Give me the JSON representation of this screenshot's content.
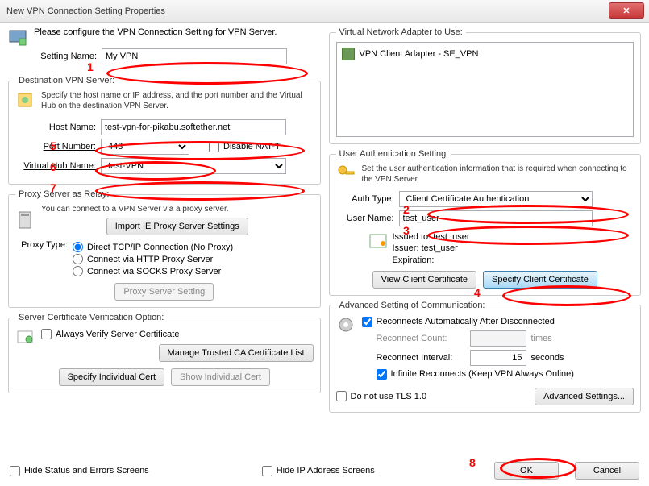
{
  "window": {
    "title": "New VPN Connection Setting Properties"
  },
  "intro": "Please configure the VPN Connection Setting for VPN Server.",
  "setting_name": {
    "label": "Setting Name:",
    "value": "My VPN"
  },
  "dest": {
    "legend": "Destination VPN Server:",
    "note": "Specify the host name or IP address, and the port number and the Virtual Hub on the destination VPN Server.",
    "host_label": "Host Name:",
    "host_value": "test-vpn-for-pikabu.softether.net",
    "port_label": "Port Number:",
    "port_value": "443",
    "nat_label": "Disable NAT-T",
    "hub_label": "Virtual Hub Name:",
    "hub_value": "test-VPN"
  },
  "proxy": {
    "legend": "Proxy Server as Relay:",
    "note": "You can connect to a VPN Server via a proxy server.",
    "import_btn": "Import IE Proxy Server Settings",
    "type_label": "Proxy Type:",
    "opt_direct": "Direct TCP/IP Connection (No Proxy)",
    "opt_http": "Connect via HTTP Proxy Server",
    "opt_socks": "Connect via SOCKS Proxy Server",
    "setting_btn": "Proxy Server Setting"
  },
  "cert": {
    "legend": "Server Certificate Verification Option:",
    "always": "Always Verify Server Certificate",
    "manage_btn": "Manage Trusted CA Certificate List",
    "specify_btn": "Specify Individual Cert",
    "show_btn": "Show Individual Cert"
  },
  "adapter": {
    "legend": "Virtual Network Adapter to Use:",
    "item": "VPN Client Adapter - SE_VPN"
  },
  "auth": {
    "legend": "User Authentication Setting:",
    "note": "Set the user authentication information that is required when connecting to the VPN Server.",
    "type_label": "Auth Type:",
    "type_value": "Client Certificate Authentication",
    "user_label": "User Name:",
    "user_value": "test_user",
    "issued_to": "Issued to: test_user",
    "issuer": "Issuer: test_user",
    "expiration": "Expiration: ",
    "view_btn": "View Client Certificate",
    "specify_btn": "Specify Client Certificate"
  },
  "adv": {
    "legend": "Advanced Setting of Communication:",
    "reconnect_auto": "Reconnects Automatically After Disconnected",
    "count_label": "Reconnect Count:",
    "count_unit": "times",
    "interval_label": "Reconnect Interval:",
    "interval_value": "15",
    "interval_unit": "seconds",
    "infinite": "Infinite Reconnects (Keep VPN Always Online)",
    "no_tls": "Do not use TLS 1.0",
    "advanced_btn": "Advanced Settings..."
  },
  "bottom": {
    "hide_status": "Hide Status and Errors Screens",
    "hide_ip": "Hide IP Address Screens",
    "ok": "OK",
    "cancel": "Cancel"
  },
  "annotations": {
    "a1": "1",
    "a2": "2",
    "a3": "3",
    "a4": "4",
    "a5": "5",
    "a6": "6",
    "a7": "7",
    "a8": "8"
  }
}
